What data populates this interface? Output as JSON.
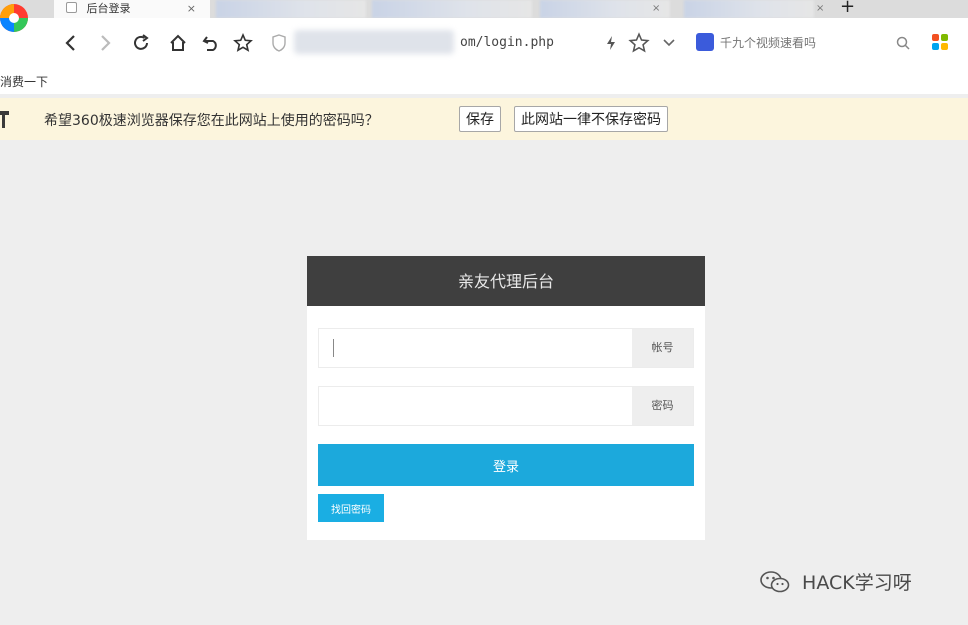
{
  "browser": {
    "active_tab": {
      "title": "后台登录",
      "close": "×"
    },
    "new_tab": "+",
    "address": {
      "url": "om/login.php"
    },
    "search": {
      "placeholder": "千九个视频速看吗"
    }
  },
  "bookmarks": {
    "item": "消费一下"
  },
  "infobar": {
    "message": "希望360极速浏览器保存您在此网站上使用的密码吗？",
    "save_label": "保存",
    "never_label": "此网站一律不保存密码"
  },
  "login": {
    "title": "亲友代理后台",
    "account_label": "帐号",
    "password_label": "密码",
    "account_value": "",
    "password_value": "",
    "submit_label": "登录",
    "reset_label": "找回密码"
  },
  "watermark": {
    "text": "HACK学习呀"
  },
  "colors": {
    "header": "#3f3f3f",
    "primary": "#1ca9dc",
    "infobar": "#fcf5dd",
    "page": "#eeeeee"
  }
}
